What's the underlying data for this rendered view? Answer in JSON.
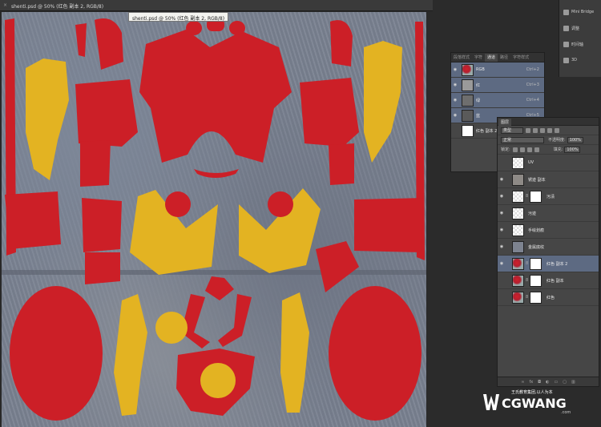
{
  "document": {
    "tab_title": "shenti.psd @ 50% (红色 副本 2, RGB/8)",
    "tooltip": "shenti.psd @ 50% (红色 副本 2, RGB/8)"
  },
  "dock": {
    "items": [
      {
        "label": "Mini Bridge",
        "icon": "bridge-icon"
      },
      {
        "label": "调整",
        "icon": "adjustments-icon"
      },
      {
        "label": "时间轴",
        "icon": "timeline-icon"
      },
      {
        "label": "3D",
        "icon": "3d-icon"
      }
    ]
  },
  "channels": {
    "tabs": [
      "段落样式",
      "字符",
      "通道",
      "路径",
      "字符样式"
    ],
    "active_tab": "通道",
    "rows": [
      {
        "label": "RGB",
        "shortcut": "Ctrl+2",
        "selected": true
      },
      {
        "label": "红",
        "shortcut": "Ctrl+3",
        "selected": true
      },
      {
        "label": "绿",
        "shortcut": "Ctrl+4",
        "selected": true
      },
      {
        "label": "蓝",
        "shortcut": "Ctrl+5",
        "selected": true
      },
      {
        "label": "红色 副本 2 蒙版",
        "shortcut": "",
        "selected": false
      }
    ]
  },
  "layers": {
    "tab": "图层",
    "filter_kind": "类型",
    "blend_mode": "正常",
    "opacity_label": "不透明度:",
    "opacity_value": "100%",
    "lock_label": "锁定:",
    "fill_label": "填充:",
    "fill_value": "100%",
    "rows": [
      {
        "name": "UV",
        "thumb": "checker",
        "mask": false,
        "selected": false,
        "visible": false
      },
      {
        "name": "锈迹 副本",
        "thumb": "texture",
        "mask": false,
        "selected": false,
        "visible": true
      },
      {
        "name": "污渍",
        "thumb": "checker",
        "mask": true,
        "selected": false,
        "visible": true
      },
      {
        "name": "污迹",
        "thumb": "checker",
        "mask": false,
        "selected": false,
        "visible": true
      },
      {
        "name": "手绘划痕",
        "thumb": "checker",
        "mask": false,
        "selected": false,
        "visible": true
      },
      {
        "name": "金属底纹",
        "thumb": "gray",
        "mask": false,
        "selected": false,
        "visible": true
      },
      {
        "name": "红色 副本 2",
        "thumb": "red",
        "mask": true,
        "selected": true,
        "visible": true
      },
      {
        "name": "红色 副本",
        "thumb": "red",
        "mask": true,
        "selected": false,
        "visible": false
      },
      {
        "name": "红色",
        "thumb": "red",
        "mask": true,
        "selected": false,
        "visible": false
      }
    ],
    "footer_icons": [
      "link-icon",
      "fx-icon",
      "mask-icon",
      "adjustment-icon",
      "folder-icon",
      "new-layer-icon",
      "trash-icon"
    ]
  },
  "watermark": {
    "tagline": "王氏教育集团,以人为本",
    "brand": "CGWANG",
    "suffix": ".com"
  },
  "colors": {
    "red": "#cc1f27",
    "yellow": "#e3b322",
    "metal": "#7a8291",
    "selection": "#5d6a82"
  }
}
